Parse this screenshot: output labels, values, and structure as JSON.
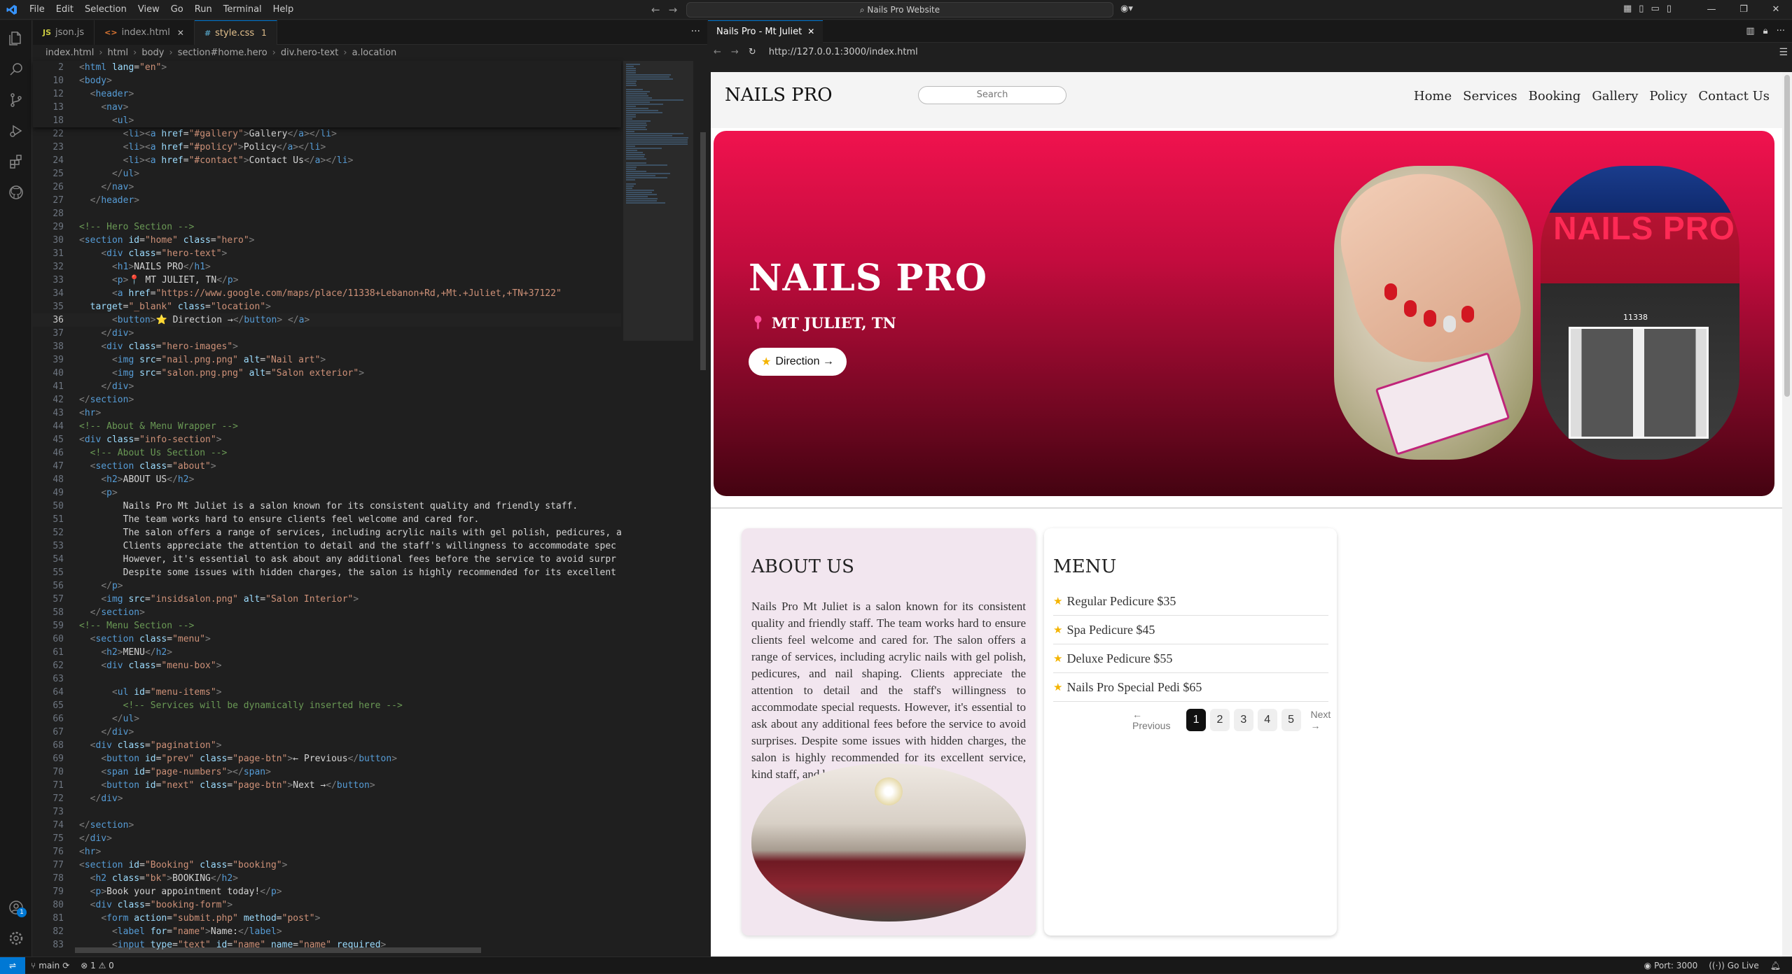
{
  "titlebar": {
    "menu": [
      "File",
      "Edit",
      "Selection",
      "View",
      "Go",
      "Run",
      "Terminal",
      "Help"
    ],
    "search": "Nails Pro Website"
  },
  "editor": {
    "tabs": [
      {
        "icon": "JS",
        "label": "json.js",
        "active": false
      },
      {
        "icon": "<>",
        "label": "index.html",
        "active": false
      },
      {
        "icon": "#",
        "label": "style.css",
        "badge": "1",
        "active": true
      }
    ],
    "breadcrumb": [
      "index.html",
      "html",
      "body",
      "section#home.hero",
      "div.hero-text",
      "a.location"
    ],
    "lines": [
      {
        "n": "2",
        "html": "<span class='t-br'>&lt;</span><span class='t-tag'>html</span> <span class='t-attr'>lang</span>=<span class='t-str'>\"en\"</span><span class='t-br'>&gt;</span>"
      },
      {
        "n": "10",
        "html": "<span class='t-br'>&lt;</span><span class='t-tag'>body</span><span class='t-br'>&gt;</span>"
      },
      {
        "n": "12",
        "html": "  <span class='t-br'>&lt;</span><span class='t-tag'>header</span><span class='t-br'>&gt;</span>"
      },
      {
        "n": "13",
        "html": "    <span class='t-br'>&lt;</span><span class='t-tag'>nav</span><span class='t-br'>&gt;</span>"
      },
      {
        "n": "18",
        "html": "      <span class='t-br'>&lt;</span><span class='t-tag'>ul</span><span class='t-br'>&gt;</span>"
      },
      {
        "n": "22",
        "html": "        <span class='t-br'>&lt;</span><span class='t-tag'>li</span><span class='t-br'>&gt;&lt;</span><span class='t-tag'>a</span> <span class='t-attr'>href</span>=<span class='t-str'>\"#gallery\"</span><span class='t-br'>&gt;</span><span class='t-txt'>Gallery</span><span class='t-br'>&lt;/</span><span class='t-tag'>a</span><span class='t-br'>&gt;&lt;/</span><span class='t-tag'>li</span><span class='t-br'>&gt;</span>"
      },
      {
        "n": "23",
        "html": "        <span class='t-br'>&lt;</span><span class='t-tag'>li</span><span class='t-br'>&gt;&lt;</span><span class='t-tag'>a</span> <span class='t-attr'>href</span>=<span class='t-str'>\"#policy\"</span><span class='t-br'>&gt;</span><span class='t-txt'>Policy</span><span class='t-br'>&lt;/</span><span class='t-tag'>a</span><span class='t-br'>&gt;&lt;/</span><span class='t-tag'>li</span><span class='t-br'>&gt;</span>"
      },
      {
        "n": "24",
        "html": "        <span class='t-br'>&lt;</span><span class='t-tag'>li</span><span class='t-br'>&gt;&lt;</span><span class='t-tag'>a</span> <span class='t-attr'>href</span>=<span class='t-str'>\"#contact\"</span><span class='t-br'>&gt;</span><span class='t-txt'>Contact Us</span><span class='t-br'>&lt;/</span><span class='t-tag'>a</span><span class='t-br'>&gt;&lt;/</span><span class='t-tag'>li</span><span class='t-br'>&gt;</span>"
      },
      {
        "n": "25",
        "html": "      <span class='t-br'>&lt;/</span><span class='t-tag'>ul</span><span class='t-br'>&gt;</span>"
      },
      {
        "n": "26",
        "html": "    <span class='t-br'>&lt;/</span><span class='t-tag'>nav</span><span class='t-br'>&gt;</span>"
      },
      {
        "n": "27",
        "html": "  <span class='t-br'>&lt;/</span><span class='t-tag'>header</span><span class='t-br'>&gt;</span>"
      },
      {
        "n": "28",
        "html": ""
      },
      {
        "n": "29",
        "html": "<span class='t-com'>&lt;!-- Hero Section --&gt;</span>"
      },
      {
        "n": "30",
        "html": "<span class='t-br'>&lt;</span><span class='t-tag'>section</span> <span class='t-attr'>id</span>=<span class='t-str'>\"home\"</span> <span class='t-attr'>class</span>=<span class='t-str'>\"hero\"</span><span class='t-br'>&gt;</span>"
      },
      {
        "n": "31",
        "html": "    <span class='t-br'>&lt;</span><span class='t-tag'>div</span> <span class='t-attr'>class</span>=<span class='t-str'>\"hero-text\"</span><span class='t-br'>&gt;</span>"
      },
      {
        "n": "32",
        "html": "      <span class='t-br'>&lt;</span><span class='t-tag'>h1</span><span class='t-br'>&gt;</span><span class='t-txt'>NAILS PRO</span><span class='t-br'>&lt;/</span><span class='t-tag'>h1</span><span class='t-br'>&gt;</span>"
      },
      {
        "n": "33",
        "html": "      <span class='t-br'>&lt;</span><span class='t-tag'>p</span><span class='t-br'>&gt;</span><span class='t-txt'>📍 MT JULIET, TN</span><span class='t-br'>&lt;/</span><span class='t-tag'>p</span><span class='t-br'>&gt;</span>"
      },
      {
        "n": "34",
        "html": "      <span class='t-br'>&lt;</span><span class='t-tag'>a</span> <span class='t-attr'>href</span>=<span class='t-str'>\"https://www.google.com/maps/place/11338+Lebanon+Rd,+Mt.+Juliet,+TN+37122\"</span>"
      },
      {
        "n": "35",
        "html": "  <span class='t-attr'>target</span>=<span class='t-str'>\"_blank\"</span> <span class='t-attr'>class</span>=<span class='t-str'>\"location\"</span><span class='t-br'>&gt;</span>"
      },
      {
        "n": "36",
        "cur": true,
        "html": "      <span class='t-br'>&lt;</span><span class='t-tag'>button</span><span class='t-br'>&gt;</span><span class='t-txt'>⭐ Direction →</span><span class='t-br'>&lt;/</span><span class='t-tag'>button</span><span class='t-br'>&gt;</span> <span class='t-br'>&lt;/</span><span class='t-tag'>a</span><span class='t-br'>&gt;</span>"
      },
      {
        "n": "37",
        "html": "    <span class='t-br'>&lt;/</span><span class='t-tag'>div</span><span class='t-br'>&gt;</span>"
      },
      {
        "n": "38",
        "html": "    <span class='t-br'>&lt;</span><span class='t-tag'>div</span> <span class='t-attr'>class</span>=<span class='t-str'>\"hero-images\"</span><span class='t-br'>&gt;</span>"
      },
      {
        "n": "39",
        "html": "      <span class='t-br'>&lt;</span><span class='t-tag'>img</span> <span class='t-attr'>src</span>=<span class='t-str'>\"nail.png.png\"</span> <span class='t-attr'>alt</span>=<span class='t-str'>\"Nail art\"</span><span class='t-br'>&gt;</span>"
      },
      {
        "n": "40",
        "html": "      <span class='t-br'>&lt;</span><span class='t-tag'>img</span> <span class='t-attr'>src</span>=<span class='t-str'>\"salon.png.png\"</span> <span class='t-attr'>alt</span>=<span class='t-str'>\"Salon exterior\"</span><span class='t-br'>&gt;</span>"
      },
      {
        "n": "41",
        "html": "    <span class='t-br'>&lt;/</span><span class='t-tag'>div</span><span class='t-br'>&gt;</span>"
      },
      {
        "n": "42",
        "html": "<span class='t-br'>&lt;/</span><span class='t-tag'>section</span><span class='t-br'>&gt;</span>"
      },
      {
        "n": "43",
        "html": "<span class='t-br'>&lt;</span><span class='t-tag'>hr</span><span class='t-br'>&gt;</span>"
      },
      {
        "n": "44",
        "html": "<span class='t-com'>&lt;!-- About &amp; Menu Wrapper --&gt;</span>"
      },
      {
        "n": "45",
        "html": "<span class='t-br'>&lt;</span><span class='t-tag'>div</span> <span class='t-attr'>class</span>=<span class='t-str'>\"info-section\"</span><span class='t-br'>&gt;</span>"
      },
      {
        "n": "46",
        "html": "  <span class='t-com'>&lt;!-- About Us Section --&gt;</span>"
      },
      {
        "n": "47",
        "html": "  <span class='t-br'>&lt;</span><span class='t-tag'>section</span> <span class='t-attr'>class</span>=<span class='t-str'>\"about\"</span><span class='t-br'>&gt;</span>"
      },
      {
        "n": "48",
        "html": "    <span class='t-br'>&lt;</span><span class='t-tag'>h2</span><span class='t-br'>&gt;</span><span class='t-txt'>ABOUT US</span><span class='t-br'>&lt;/</span><span class='t-tag'>h2</span><span class='t-br'>&gt;</span>"
      },
      {
        "n": "49",
        "html": "    <span class='t-br'>&lt;</span><span class='t-tag'>p</span><span class='t-br'>&gt;</span>"
      },
      {
        "n": "50",
        "html": "<span class='t-txt'>        Nails Pro Mt Juliet is a salon known for its consistent quality and friendly staff.</span>"
      },
      {
        "n": "51",
        "html": "<span class='t-txt'>        The team works hard to ensure clients feel welcome and cared for.</span>"
      },
      {
        "n": "52",
        "html": "<span class='t-txt'>        The salon offers a range of services, including acrylic nails with gel polish, pedicures, a</span>"
      },
      {
        "n": "53",
        "html": "<span class='t-txt'>        Clients appreciate the attention to detail and the staff's willingness to accommodate spec</span>"
      },
      {
        "n": "54",
        "html": "<span class='t-txt'>        However, it's essential to ask about any additional fees before the service to avoid surpr</span>"
      },
      {
        "n": "55",
        "html": "<span class='t-txt'>        Despite some issues with hidden charges, the salon is highly recommended for its excellent</span>"
      },
      {
        "n": "56",
        "html": "    <span class='t-br'>&lt;/</span><span class='t-tag'>p</span><span class='t-br'>&gt;</span>"
      },
      {
        "n": "57",
        "html": "    <span class='t-br'>&lt;</span><span class='t-tag'>img</span> <span class='t-attr'>src</span>=<span class='t-str'>\"insidsalon.png\"</span> <span class='t-attr'>alt</span>=<span class='t-str'>\"Salon Interior\"</span><span class='t-br'>&gt;</span>"
      },
      {
        "n": "58",
        "html": "  <span class='t-br'>&lt;/</span><span class='t-tag'>section</span><span class='t-br'>&gt;</span>"
      },
      {
        "n": "59",
        "html": "<span class='t-com'>&lt;!-- Menu Section --&gt;</span>"
      },
      {
        "n": "60",
        "html": "  <span class='t-br'>&lt;</span><span class='t-tag'>section</span> <span class='t-attr'>class</span>=<span class='t-str'>\"menu\"</span><span class='t-br'>&gt;</span>"
      },
      {
        "n": "61",
        "html": "    <span class='t-br'>&lt;</span><span class='t-tag'>h2</span><span class='t-br'>&gt;</span><span class='t-txt'>MENU</span><span class='t-br'>&lt;/</span><span class='t-tag'>h2</span><span class='t-br'>&gt;</span>"
      },
      {
        "n": "62",
        "html": "    <span class='t-br'>&lt;</span><span class='t-tag'>div</span> <span class='t-attr'>class</span>=<span class='t-str'>\"menu-box\"</span><span class='t-br'>&gt;</span>"
      },
      {
        "n": "63",
        "html": ""
      },
      {
        "n": "64",
        "html": "      <span class='t-br'>&lt;</span><span class='t-tag'>ul</span> <span class='t-attr'>id</span>=<span class='t-str'>\"menu-items\"</span><span class='t-br'>&gt;</span>"
      },
      {
        "n": "65",
        "html": "        <span class='t-com'>&lt;!-- Services will be dynamically inserted here --&gt;</span>"
      },
      {
        "n": "66",
        "html": "      <span class='t-br'>&lt;/</span><span class='t-tag'>ul</span><span class='t-br'>&gt;</span>"
      },
      {
        "n": "67",
        "html": "    <span class='t-br'>&lt;/</span><span class='t-tag'>div</span><span class='t-br'>&gt;</span>"
      },
      {
        "n": "68",
        "html": "  <span class='t-br'>&lt;</span><span class='t-tag'>div</span> <span class='t-attr'>class</span>=<span class='t-str'>\"pagination\"</span><span class='t-br'>&gt;</span>"
      },
      {
        "n": "69",
        "html": "    <span class='t-br'>&lt;</span><span class='t-tag'>button</span> <span class='t-attr'>id</span>=<span class='t-str'>\"prev\"</span> <span class='t-attr'>class</span>=<span class='t-str'>\"page-btn\"</span><span class='t-br'>&gt;</span><span class='t-txt'>← Previous</span><span class='t-br'>&lt;/</span><span class='t-tag'>button</span><span class='t-br'>&gt;</span>"
      },
      {
        "n": "70",
        "html": "    <span class='t-br'>&lt;</span><span class='t-tag'>span</span> <span class='t-attr'>id</span>=<span class='t-str'>\"page-numbers\"</span><span class='t-br'>&gt;&lt;/</span><span class='t-tag'>span</span><span class='t-br'>&gt;</span>"
      },
      {
        "n": "71",
        "html": "    <span class='t-br'>&lt;</span><span class='t-tag'>button</span> <span class='t-attr'>id</span>=<span class='t-str'>\"next\"</span> <span class='t-attr'>class</span>=<span class='t-str'>\"page-btn\"</span><span class='t-br'>&gt;</span><span class='t-txt'>Next →</span><span class='t-br'>&lt;/</span><span class='t-tag'>button</span><span class='t-br'>&gt;</span>"
      },
      {
        "n": "72",
        "html": "  <span class='t-br'>&lt;/</span><span class='t-tag'>div</span><span class='t-br'>&gt;</span>"
      },
      {
        "n": "73",
        "html": ""
      },
      {
        "n": "74",
        "html": "<span class='t-br'>&lt;/</span><span class='t-tag'>section</span><span class='t-br'>&gt;</span>"
      },
      {
        "n": "75",
        "html": "<span class='t-br'>&lt;/</span><span class='t-tag'>div</span><span class='t-br'>&gt;</span>"
      },
      {
        "n": "76",
        "html": "<span class='t-br'>&lt;</span><span class='t-tag'>hr</span><span class='t-br'>&gt;</span>"
      },
      {
        "n": "77",
        "html": "<span class='t-br'>&lt;</span><span class='t-tag'>section</span> <span class='t-attr'>id</span>=<span class='t-str'>\"Booking\"</span> <span class='t-attr'>class</span>=<span class='t-str'>\"booking\"</span><span class='t-br'>&gt;</span>"
      },
      {
        "n": "78",
        "html": "  <span class='t-br'>&lt;</span><span class='t-tag'>h2</span> <span class='t-attr'>class</span>=<span class='t-str'>\"bk\"</span><span class='t-br'>&gt;</span><span class='t-txt'>BOOKING</span><span class='t-br'>&lt;/</span><span class='t-tag'>h2</span><span class='t-br'>&gt;</span>"
      },
      {
        "n": "79",
        "html": "  <span class='t-br'>&lt;</span><span class='t-tag'>p</span><span class='t-br'>&gt;</span><span class='t-txt'>Book your appointment today!</span><span class='t-br'>&lt;/</span><span class='t-tag'>p</span><span class='t-br'>&gt;</span>"
      },
      {
        "n": "80",
        "html": "  <span class='t-br'>&lt;</span><span class='t-tag'>div</span> <span class='t-attr'>class</span>=<span class='t-str'>\"booking-form\"</span><span class='t-br'>&gt;</span>"
      },
      {
        "n": "81",
        "html": "    <span class='t-br'>&lt;</span><span class='t-tag'>form</span> <span class='t-attr'>action</span>=<span class='t-str'>\"submit.php\"</span> <span class='t-attr'>method</span>=<span class='t-str'>\"post\"</span><span class='t-br'>&gt;</span>"
      },
      {
        "n": "82",
        "html": "      <span class='t-br'>&lt;</span><span class='t-tag'>label</span> <span class='t-attr'>for</span>=<span class='t-str'>\"name\"</span><span class='t-br'>&gt;</span><span class='t-txt'>Name:</span><span class='t-br'>&lt;/</span><span class='t-tag'>label</span><span class='t-br'>&gt;</span>"
      },
      {
        "n": "83",
        "html": "      <span class='t-br'>&lt;</span><span class='t-tag'>input</span> <span class='t-attr'>type</span>=<span class='t-str'>\"text\"</span> <span class='t-attr'>id</span>=<span class='t-str'>\"name\"</span> <span class='t-attr'>name</span>=<span class='t-str'>\"name\"</span> <span class='t-attr'>required</span><span class='t-br'>&gt;</span>"
      }
    ]
  },
  "browser": {
    "tab_title": "Nails Pro - Mt Juliet",
    "url": "http://127.0.0.1:3000/index.html"
  },
  "site": {
    "logo": "NAILS PRO",
    "search_placeholder": "Search",
    "nav": [
      "Home",
      "Services",
      "Booking",
      "Gallery",
      "Policy",
      "Contact Us"
    ],
    "hero": {
      "title": "NAILS PRO",
      "location": "MT JULIET, TN",
      "button": "Direction →",
      "salon_sign": "NAILS PRO",
      "salon_number": "11338"
    },
    "about": {
      "heading": "ABOUT US",
      "text": "Nails Pro Mt Juliet is a salon known for its consistent quality and friendly staff. The team works hard to ensure clients feel welcome and cared for. The salon offers a range of services, including acrylic nails with gel polish, pedicures, and nail shaping. Clients appreciate the attention to detail and the staff's willingness to accommodate special requests. However, it's essential to ask about any additional fees before the service to avoid surprises. Despite some issues with hidden charges, the salon is highly recommended for its excellent service, kind staff, and beautiful results."
    },
    "menu": {
      "heading": "MENU",
      "items": [
        "Regular Pedicure $35",
        "Spa Pedicure $45",
        "Deluxe Pedicure $55",
        "Nails Pro Special Pedi $65"
      ],
      "prev": "← Previous",
      "next": "Next →",
      "pages": [
        "1",
        "2",
        "3",
        "4",
        "5"
      ],
      "current_page": "1"
    }
  },
  "statusbar": {
    "branch": "main",
    "problems": "⊗ 1 ⚠ 0",
    "port": "Port: 3000",
    "golive": "Go Live"
  },
  "colors": {
    "accent": "#0078d4",
    "hero_top": "#f0124e",
    "hero_bottom": "#440311",
    "about_bg": "#f2e6ef"
  }
}
